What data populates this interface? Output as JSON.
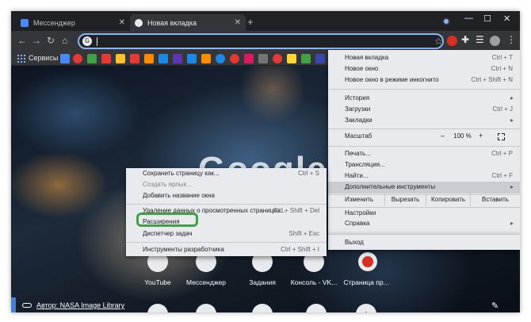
{
  "tabs": [
    {
      "title": "Мессенджер",
      "active": false
    },
    {
      "title": "Новая вкладка",
      "active": true
    }
  ],
  "window_controls": {
    "minimize": "—",
    "maximize": "☐",
    "close": "✕"
  },
  "toolbar": {
    "back": "←",
    "forward": "→",
    "reload": "↻",
    "home": "⌂",
    "url": "",
    "omnibox_glyph": "G",
    "star": "☆",
    "menu_glyph": "⋮"
  },
  "bookmarks": {
    "apps_label": "Сервисы"
  },
  "ntp": {
    "logo": "Google",
    "shortcuts": [
      {
        "label": "YouTube"
      },
      {
        "label": "Мессенджер"
      },
      {
        "label": "Задания"
      },
      {
        "label": "Консоль - VK..."
      },
      {
        "label": "Страница пр..."
      }
    ],
    "author": "Автор: NASA Image Library"
  },
  "main_menu": {
    "items": [
      {
        "label": "Новая вкладка",
        "shortcut": "Ctrl + T"
      },
      {
        "label": "Новое окно",
        "shortcut": "Ctrl + N"
      },
      {
        "label": "Новое окно в режиме инкогнито",
        "shortcut": "Ctrl + Shift + N"
      },
      {
        "label": "История",
        "shortcut": "▸"
      },
      {
        "label": "Загрузки",
        "shortcut": "Ctrl + J"
      },
      {
        "label": "Закладки",
        "shortcut": "▸"
      }
    ],
    "zoom": {
      "label": "Масштаб",
      "minus": "–",
      "value": "100 %",
      "plus": "+"
    },
    "items2": [
      {
        "label": "Печать...",
        "shortcut": "Ctrl + P"
      },
      {
        "label": "Трансляция...",
        "shortcut": ""
      },
      {
        "label": "Найти...",
        "shortcut": "Ctrl + F"
      },
      {
        "label": "Дополнительные инструменты",
        "shortcut": "▸"
      }
    ],
    "edit": {
      "label": "Изменить",
      "cut": "Вырезать",
      "copy": "Копировать",
      "paste": "Вставить"
    },
    "items3": [
      {
        "label": "Настройки",
        "shortcut": ""
      },
      {
        "label": "Справка",
        "shortcut": "▸"
      },
      {
        "label": "Выход",
        "shortcut": ""
      }
    ]
  },
  "sub_menu": {
    "items": [
      {
        "label": "Сохранить страницу как...",
        "shortcut": "Ctrl + S"
      },
      {
        "label": "Создать ярлык...",
        "shortcut": ""
      },
      {
        "label": "Добавить название окна",
        "shortcut": ""
      },
      {
        "label": "Удаление данных о просмотренных страницах...",
        "shortcut": "Ctrl + Shift + Del"
      },
      {
        "label": "Расширения",
        "shortcut": ""
      },
      {
        "label": "Диспетчер задач",
        "shortcut": "Shift + Esc"
      },
      {
        "label": "Инструменты разработчика",
        "shortcut": "Ctrl + Shift + I"
      }
    ]
  }
}
